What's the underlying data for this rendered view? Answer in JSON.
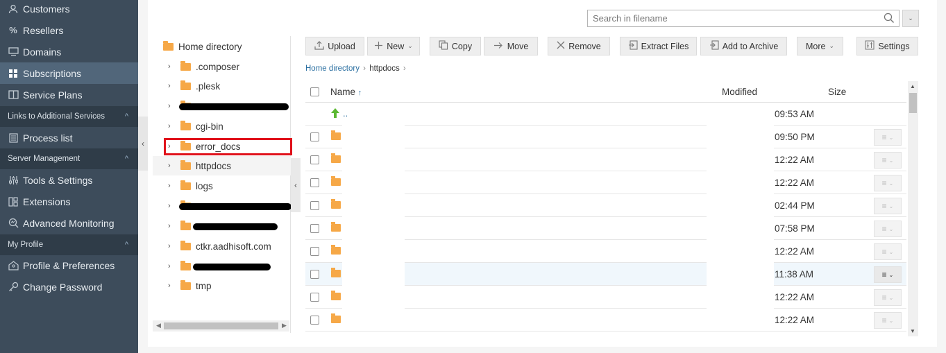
{
  "sidebar": {
    "items_top": [
      {
        "label": "Customers",
        "icon": "user-icon"
      },
      {
        "label": "Resellers",
        "icon": "percent-icon"
      },
      {
        "label": "Domains",
        "icon": "monitor-icon"
      },
      {
        "label": "Subscriptions",
        "icon": "grid-icon",
        "active": true
      },
      {
        "label": "Service Plans",
        "icon": "book-icon"
      }
    ],
    "section_links": "Links to Additional Services",
    "process_list": "Process list",
    "section_server": "Server Management",
    "server_items": [
      {
        "label": "Tools & Settings",
        "icon": "sliders-icon"
      },
      {
        "label": "Extensions",
        "icon": "extensions-icon"
      },
      {
        "label": "Advanced Monitoring",
        "icon": "monitoring-icon"
      }
    ],
    "section_profile": "My Profile",
    "profile_items": [
      {
        "label": "Profile & Preferences",
        "icon": "profile-icon"
      },
      {
        "label": "Change Password",
        "icon": "key-icon"
      }
    ]
  },
  "search": {
    "placeholder": "Search in filename"
  },
  "tree": {
    "root": "Home directory",
    "items": [
      ".composer",
      ".plesk",
      "",
      "cgi-bin",
      "error_docs",
      "httpdocs",
      "logs",
      "",
      "",
      "ctkr.aadhisoft.com",
      "",
      "tmp"
    ]
  },
  "toolbar": {
    "upload": "Upload",
    "new": "New",
    "copy": "Copy",
    "move": "Move",
    "remove": "Remove",
    "extract": "Extract Files",
    "archive": "Add to Archive",
    "more": "More",
    "settings": "Settings"
  },
  "breadcrumb": {
    "home": "Home directory",
    "current": "httpdocs"
  },
  "table": {
    "col_name": "Name",
    "col_modified": "Modified",
    "col_size": "Size",
    "parent_label": "..",
    "times": [
      "09:53 AM",
      "09:50 PM",
      "12:22 AM",
      "12:22 AM",
      "02:44 PM",
      "07:58 PM",
      "12:22 AM",
      "11:38 AM",
      "12:22 AM",
      "12:22 AM"
    ]
  },
  "colors": {
    "sidebar_bg": "#3d4c5b",
    "sidebar_section": "#2f3c48",
    "active": "#51667a",
    "folder": "#f6a847",
    "link": "#2a6fa1",
    "highlight_box": "#e0121b"
  }
}
